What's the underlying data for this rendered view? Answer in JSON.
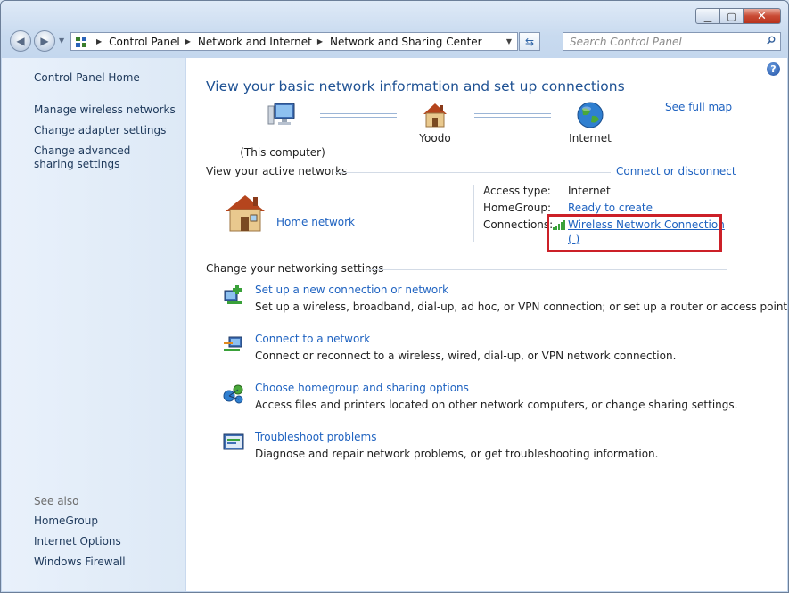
{
  "window": {
    "minimize_label": "▁",
    "maximize_label": "▢",
    "close_label": "✕"
  },
  "address": {
    "crumbs": [
      "Control Panel",
      "Network and Internet",
      "Network and Sharing Center"
    ]
  },
  "search": {
    "placeholder": "Search Control Panel"
  },
  "sidebar": {
    "home": "Control Panel Home",
    "links": [
      "Manage wireless networks",
      "Change adapter settings",
      "Change advanced sharing settings"
    ],
    "see_also_title": "See also",
    "see_also": [
      "HomeGroup",
      "Internet Options",
      "Windows Firewall"
    ]
  },
  "main": {
    "title": "View your basic network information and set up connections",
    "see_full_map": "See full map",
    "map": {
      "computer": "(This computer)",
      "router": "Yoodo",
      "internet": "Internet"
    },
    "active_networks": {
      "heading": "View your active networks",
      "connect_link": "Connect or disconnect",
      "network_name": "Home network",
      "access_type_label": "Access type:",
      "access_type_value": "Internet",
      "homegroup_label": "HomeGroup:",
      "homegroup_value": "Ready to create",
      "connections_label": "Connections:",
      "connection_line1": "Wireless Network Connection",
      "connection_line2": "(         )"
    },
    "settings": {
      "heading": "Change your networking settings",
      "tasks": [
        {
          "title": "Set up a new connection or network",
          "desc": "Set up a wireless, broadband, dial-up, ad hoc, or VPN connection; or set up a router or access point.",
          "icon": "new-connection-icon"
        },
        {
          "title": "Connect to a network",
          "desc": "Connect or reconnect to a wireless, wired, dial-up, or VPN network connection.",
          "icon": "connect-network-icon"
        },
        {
          "title": "Choose homegroup and sharing options",
          "desc": "Access files and printers located on other network computers, or change sharing settings.",
          "icon": "homegroup-icon"
        },
        {
          "title": "Troubleshoot problems",
          "desc": "Diagnose and repair network problems, or get troubleshooting information.",
          "icon": "troubleshoot-icon"
        }
      ]
    }
  },
  "colors": {
    "link": "#1e62c0",
    "title": "#1e5193",
    "highlight": "#cc2028",
    "sidebar_text": "#1e395b"
  }
}
